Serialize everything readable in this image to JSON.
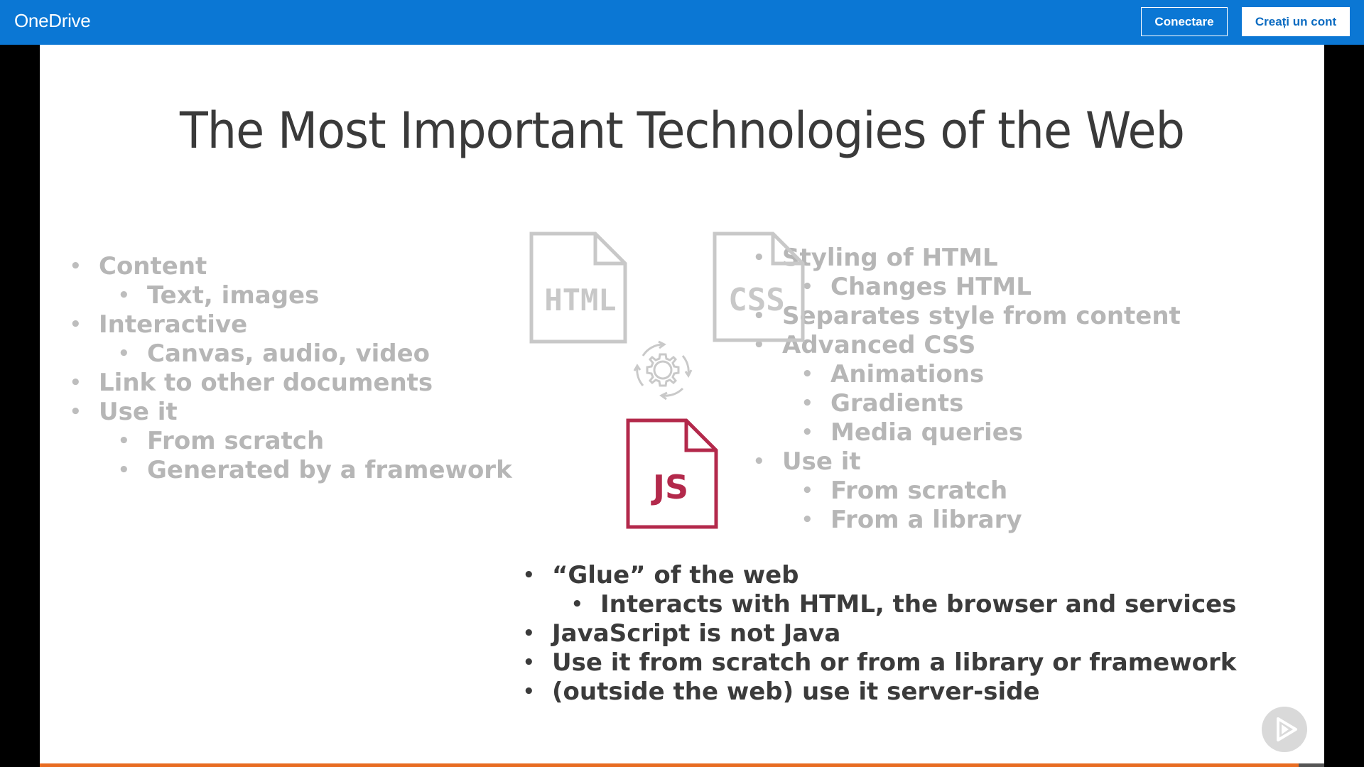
{
  "header": {
    "brand": "OneDrive",
    "sign_in_label": "Conectare",
    "create_account_label": "Creați un cont",
    "color": "#0b77d4"
  },
  "slide": {
    "title": "The Most Important Technologies of the Web",
    "html_list": [
      {
        "text": "Content",
        "level": 1
      },
      {
        "text": "Text, images",
        "level": 2
      },
      {
        "text": "Interactive",
        "level": 1
      },
      {
        "text": "Canvas, audio, video",
        "level": 2
      },
      {
        "text": "Link to other documents",
        "level": 1
      },
      {
        "text": "Use it",
        "level": 1
      },
      {
        "text": "From scratch",
        "level": 2
      },
      {
        "text": "Generated by a framework",
        "level": 2
      }
    ],
    "css_list": [
      {
        "text": "Styling of HTML",
        "level": 1
      },
      {
        "text": "Changes HTML",
        "level": 2
      },
      {
        "text": "Separates style from content",
        "level": 1
      },
      {
        "text": "Advanced CSS",
        "level": 1
      },
      {
        "text": "Animations",
        "level": 2
      },
      {
        "text": "Gradients",
        "level": 2
      },
      {
        "text": "Media queries",
        "level": 2
      },
      {
        "text": "Use it",
        "level": 1
      },
      {
        "text": "From scratch",
        "level": 2
      },
      {
        "text": "From a library",
        "level": 2
      }
    ],
    "js_list": [
      {
        "text": "“Glue” of the web",
        "level": 1
      },
      {
        "text": "Interacts with HTML, the browser and services",
        "level": 2
      },
      {
        "text": "JavaScript is not Java",
        "level": 1
      },
      {
        "text": "Use it from scratch or from a library or framework",
        "level": 1
      },
      {
        "text": "(outside the web) use it server-side",
        "level": 1
      }
    ],
    "icons": {
      "html_label": "HTML",
      "css_label": "CSS",
      "js_label": "JS",
      "js_color": "#b3294b",
      "faded_color": "#c8c8c8"
    }
  },
  "player": {
    "progress": 0.98,
    "progress_color": "#e86c22"
  }
}
